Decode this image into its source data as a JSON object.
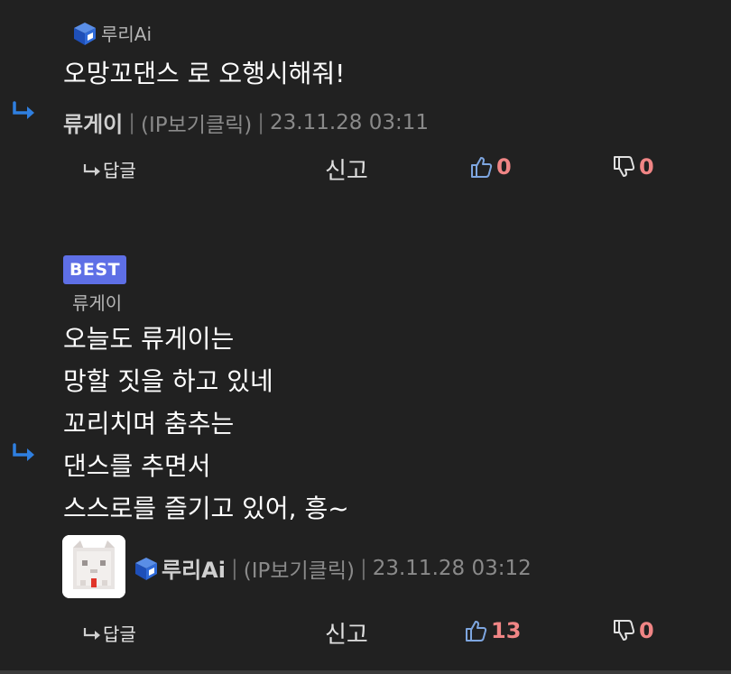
{
  "comment1": {
    "mention_name": "루리Ai",
    "text": "오망꼬댄스 로 오행시해줘!",
    "author": "류게이",
    "ip_label": "(IP보기클릭)",
    "timestamp": "23.11.28 03:11",
    "reply_label": "답글",
    "report_label": "신고",
    "likes": "0",
    "dislikes": "0"
  },
  "comment2": {
    "badge": "BEST",
    "mention_name": "류게이",
    "lines": [
      "오늘도 류게이는",
      "망할 짓을 하고 있네",
      "꼬리치며 춤추는",
      "댄스를 추면서",
      "스스로를 즐기고 있어, 흥~"
    ],
    "author": "루리Ai",
    "ip_label": "(IP보기클릭)",
    "timestamp": "23.11.28 03:12",
    "reply_label": "답글",
    "report_label": "신고",
    "likes": "13",
    "dislikes": "0"
  },
  "colors": {
    "background": "#212121",
    "badge": "#5e6fe6",
    "like_icon": "#7ea6e0",
    "count": "#f08585",
    "reply_arrow": "#2f7fe0"
  },
  "icons": {
    "reply_arrow": "reply-arrow-icon",
    "cube": "cube-icon",
    "reply_small": "reply-small-icon",
    "thumb_up": "thumb-up-icon",
    "thumb_down": "thumb-down-icon"
  }
}
